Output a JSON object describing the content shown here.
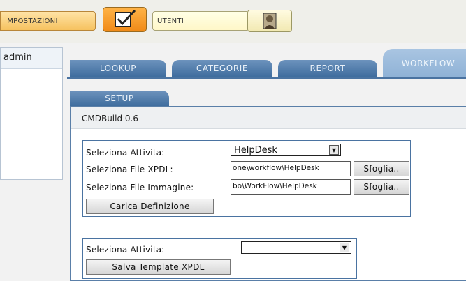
{
  "topbar": {
    "impostazioni_label": "IMPOSTAZIONI",
    "utenti_label": "UTENTI",
    "impostazioni_icon": "checkbox-icon",
    "utenti_icon": "user-icon"
  },
  "left_panel": {
    "user": "admin"
  },
  "tabs": [
    {
      "label": "LOOKUP"
    },
    {
      "label": "CATEGORIE"
    },
    {
      "label": "REPORT"
    },
    {
      "label": "WORKFLOW"
    }
  ],
  "subtab": {
    "label": "SETUP"
  },
  "version": "CMDBuild 0.6",
  "form1": {
    "activity_label": "Seleziona Attivita:",
    "activity_value": "HelpDesk",
    "xpdl_label": "Seleziona File XPDL:",
    "xpdl_value": "one\\workflow\\HelpDesk",
    "image_label": "Seleziona File Immagine:",
    "image_value": "bo\\WorkFlow\\HelpDesk",
    "browse_label": "Sfoglia..",
    "load_button": "Carica Definizione"
  },
  "form2": {
    "activity_label": "Seleziona Attivita:",
    "activity_value": "",
    "save_button": "Salva Template XPDL"
  },
  "colors": {
    "tab_blue": "#3f6d9e",
    "tab_active": "#8fb2d6",
    "orange": "#f08a18"
  }
}
